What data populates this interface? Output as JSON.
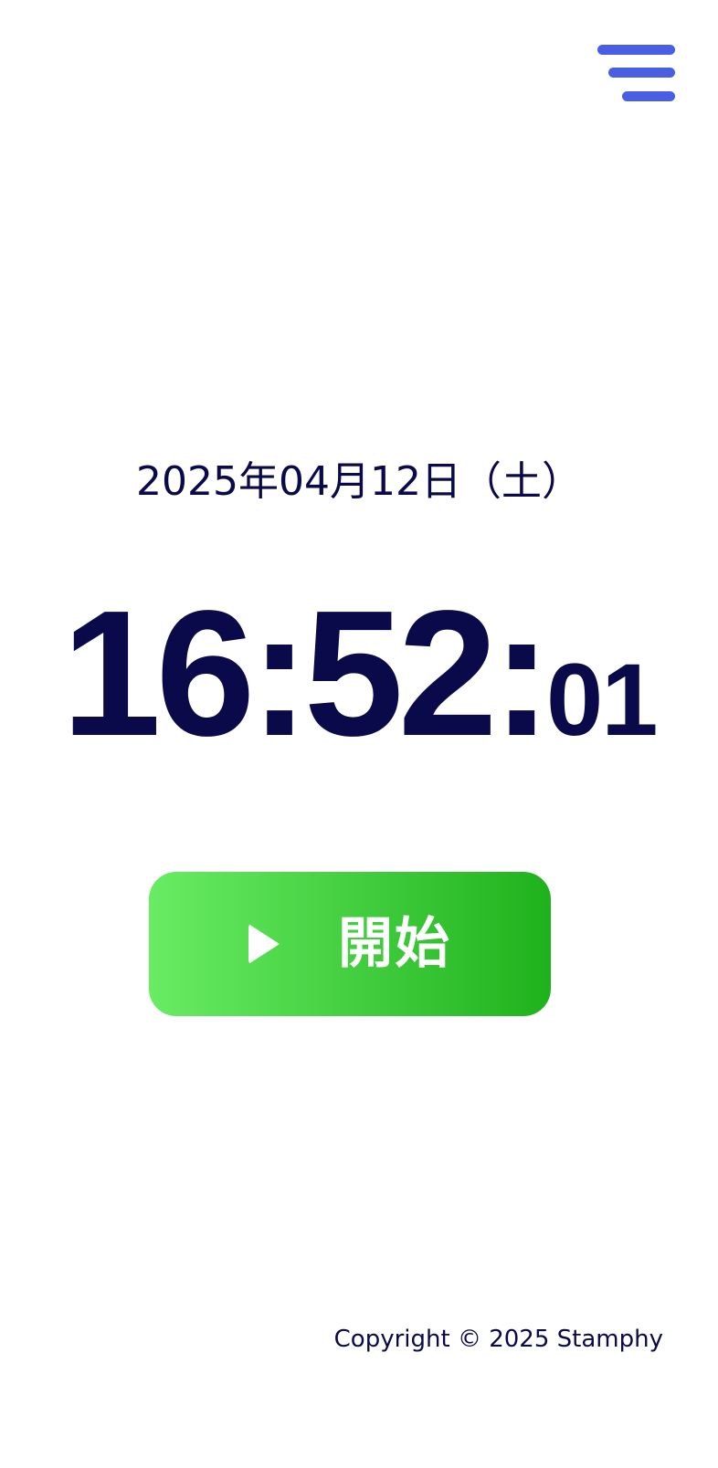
{
  "colors": {
    "text_primary": "#0a0a4a",
    "menu_icon": "#4a5ee4",
    "start_button_gradient_start": "#69ec63",
    "start_button_gradient_end": "#1fb21d",
    "start_button_text": "#ffffff"
  },
  "header": {
    "menu_icon": "hamburger-menu-icon"
  },
  "main": {
    "date": "2025年04月12日（土）",
    "time_hours_minutes": "16:52:",
    "time_seconds": "01",
    "start_button": {
      "icon": "play-icon",
      "label": "開始"
    }
  },
  "footer": {
    "copyright": "Copyright © 2025 Stamphy"
  }
}
